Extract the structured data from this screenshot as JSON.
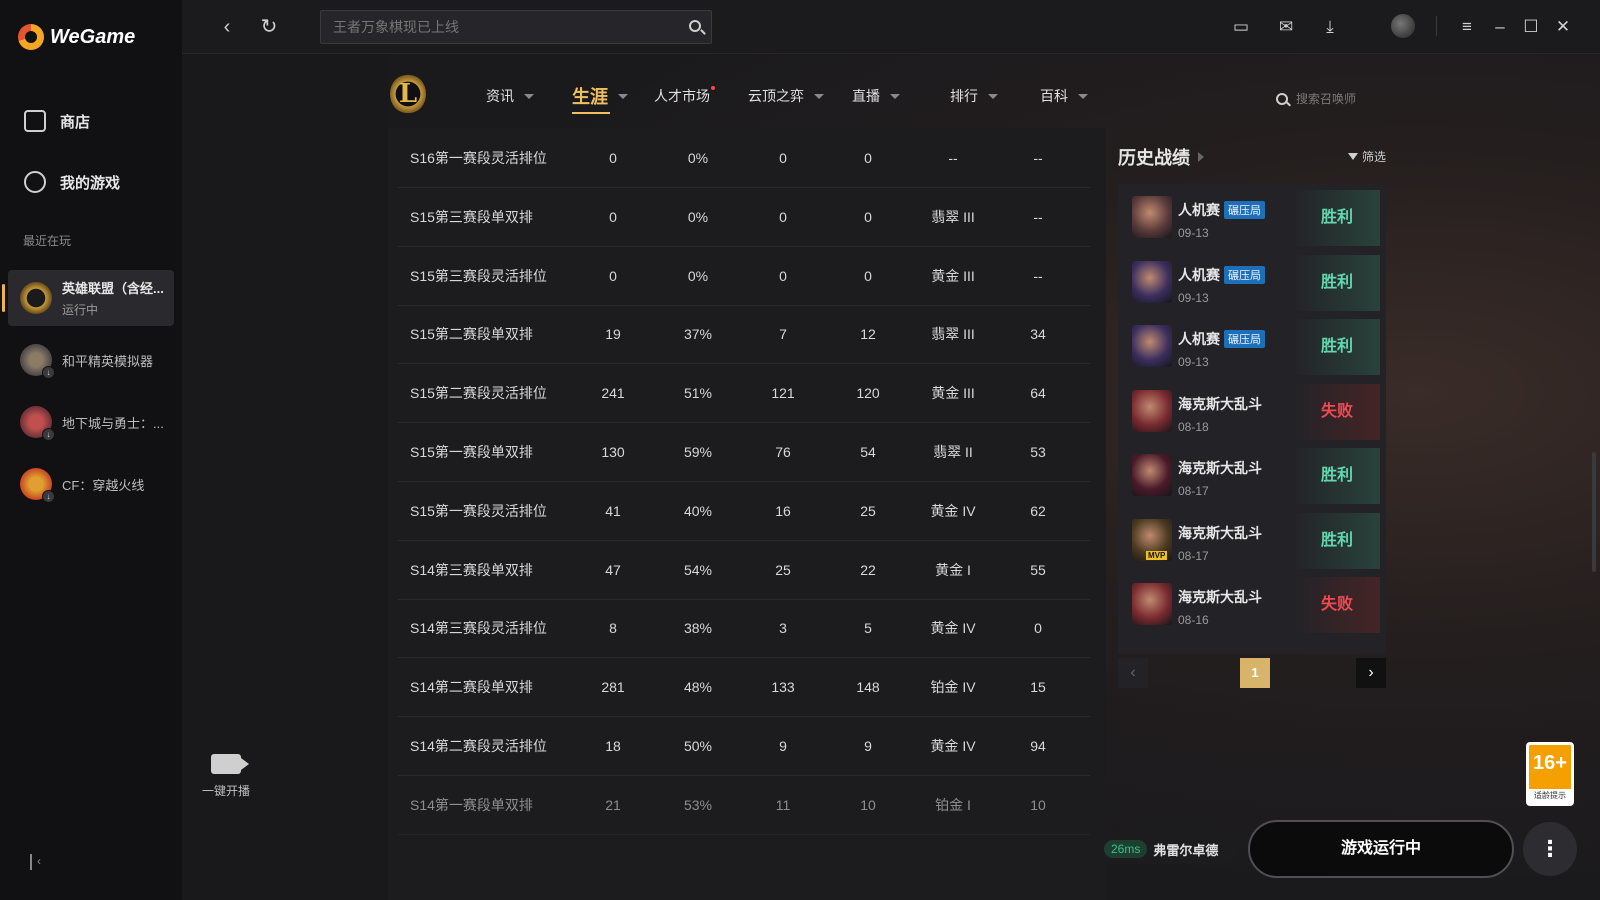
{
  "app": {
    "brand": "WeGame"
  },
  "sidebar": {
    "nav": [
      {
        "label": "商店",
        "icon": "bag-icon"
      },
      {
        "label": "我的游戏",
        "icon": "gamepad-icon"
      }
    ],
    "recent_title": "最近在玩",
    "games": [
      {
        "name": "英雄联盟（含经...",
        "status": "运行中",
        "icon": "lol-icon"
      },
      {
        "name": "和平精英模拟器",
        "icon": "pubg-icon"
      },
      {
        "name": "地下城与勇士：...",
        "icon": "dnf-icon"
      },
      {
        "name": "CF：穿越火线",
        "icon": "cf-icon"
      }
    ]
  },
  "topbar": {
    "search_placeholder": "王者万象棋现已上线"
  },
  "stream": {
    "label": "一键开播"
  },
  "game_nav": {
    "items": [
      {
        "label": "资讯"
      },
      {
        "label": "生涯"
      },
      {
        "label": "人才市场"
      },
      {
        "label": "云顶之弈"
      },
      {
        "label": "直播"
      },
      {
        "label": "排行"
      },
      {
        "label": "百科"
      }
    ],
    "active": "生涯",
    "summoner_search_placeholder": "搜索召唤师"
  },
  "table": {
    "rows": [
      [
        "S16第一赛段灵活排位",
        "0",
        "0%",
        "0",
        "0",
        "--",
        "--"
      ],
      [
        "S15第三赛段单双排",
        "0",
        "0%",
        "0",
        "0",
        "翡翠 III",
        "--"
      ],
      [
        "S15第三赛段灵活排位",
        "0",
        "0%",
        "0",
        "0",
        "黄金 III",
        "--"
      ],
      [
        "S15第二赛段单双排",
        "19",
        "37%",
        "7",
        "12",
        "翡翠 III",
        "34"
      ],
      [
        "S15第二赛段灵活排位",
        "241",
        "51%",
        "121",
        "120",
        "黄金 III",
        "64"
      ],
      [
        "S15第一赛段单双排",
        "130",
        "59%",
        "76",
        "54",
        "翡翠 II",
        "53"
      ],
      [
        "S15第一赛段灵活排位",
        "41",
        "40%",
        "16",
        "25",
        "黄金 IV",
        "62"
      ],
      [
        "S14第三赛段单双排",
        "47",
        "54%",
        "25",
        "22",
        "黄金 I",
        "55"
      ],
      [
        "S14第三赛段灵活排位",
        "8",
        "38%",
        "3",
        "5",
        "黄金 IV",
        "0"
      ],
      [
        "S14第二赛段单双排",
        "281",
        "48%",
        "133",
        "148",
        "铂金 IV",
        "15"
      ],
      [
        "S14第二赛段灵活排位",
        "18",
        "50%",
        "9",
        "9",
        "黄金 IV",
        "94"
      ],
      [
        "S14第一赛段单双排",
        "21",
        "53%",
        "11",
        "10",
        "铂金 I",
        "10"
      ]
    ]
  },
  "history": {
    "title": "历史战绩",
    "filter_label": "筛选",
    "matches": [
      {
        "mode": "人机赛",
        "tag": "碾压局",
        "date": "09-13",
        "result": "胜利",
        "win": true,
        "champ_color": "#5a3a3a"
      },
      {
        "mode": "人机赛",
        "tag": "碾压局",
        "date": "09-13",
        "result": "胜利",
        "win": true,
        "champ_color": "#3b2f5e"
      },
      {
        "mode": "人机赛",
        "tag": "碾压局",
        "date": "09-13",
        "result": "胜利",
        "win": true,
        "champ_color": "#3b2f5e"
      },
      {
        "mode": "海克斯大乱斗",
        "date": "08-18",
        "result": "失败",
        "win": false,
        "champ_color": "#7a2a30"
      },
      {
        "mode": "海克斯大乱斗",
        "date": "08-17",
        "result": "胜利",
        "win": true,
        "champ_color": "#4a1a2a"
      },
      {
        "mode": "海克斯大乱斗",
        "date": "08-17",
        "result": "胜利",
        "win": true,
        "champ_color": "#4a3a20",
        "mvp": "MVP"
      },
      {
        "mode": "海克斯大乱斗",
        "date": "08-16",
        "result": "失败",
        "win": false,
        "champ_color": "#7a2a30"
      }
    ],
    "page": "1"
  },
  "age_rating": {
    "value": "16+",
    "label": "适龄提示"
  },
  "bottom": {
    "ping": "26ms",
    "server": "弗雷尔卓德",
    "game_status_button": "游戏运行中"
  },
  "colors": {
    "accent": "#f0c060",
    "win": "#63d6b0",
    "lose": "#ef4a52"
  }
}
